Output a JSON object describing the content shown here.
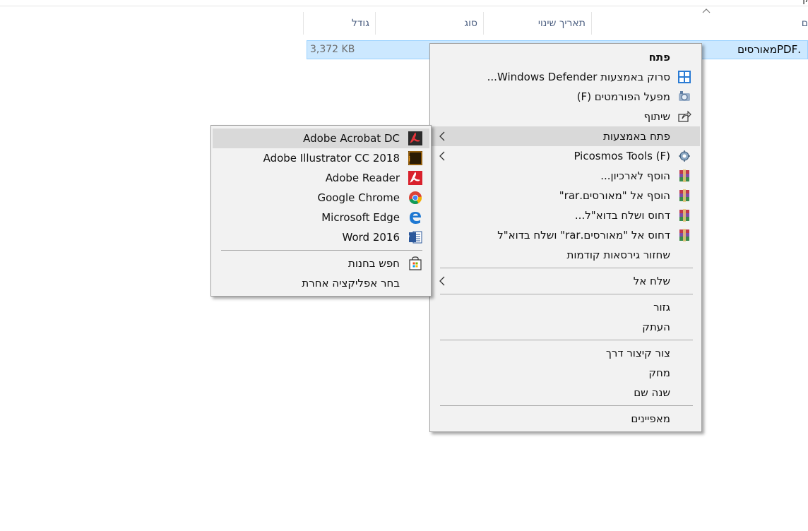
{
  "explorer": {
    "top_char": "ק",
    "columns": {
      "name_char": "ם",
      "modified": "תאריך שינוי",
      "type": "סוג",
      "size": "גודל"
    },
    "selected_file": {
      "name": ".PDFמאורסים",
      "size": "3,372 KB"
    }
  },
  "context_menu": {
    "items": [
      {
        "label": "פתח",
        "icon": "none"
      },
      {
        "label": "סרוק באמצעות Windows Defender...",
        "icon": "defender-icon"
      },
      {
        "label": "מפעל הפורמטים (F)",
        "icon": "format-factory-icon"
      },
      {
        "label": "שיתוף",
        "icon": "share-icon"
      },
      {
        "label": "פתח באמצעות",
        "icon": "none",
        "submenu": true
      },
      {
        "label": "Picosmos Tools (F)",
        "icon": "picosmos-icon",
        "submenu": true
      },
      {
        "label": "הוסף לארכיון...",
        "icon": "winrar-icon"
      },
      {
        "label": "הוסף אל \"מאורסים.rar\"",
        "icon": "winrar-icon"
      },
      {
        "label": "דחוס ושלח בדוא\"ל...",
        "icon": "winrar-icon"
      },
      {
        "label": "דחוס אל \"מאורסים.rar\" ושלח בדוא\"ל",
        "icon": "winrar-icon"
      },
      {
        "label": "שחזור גירסאות קודמות",
        "icon": "none"
      },
      {
        "label": "שלח אל",
        "icon": "none",
        "submenu": true
      },
      {
        "label": "גזור",
        "icon": "none"
      },
      {
        "label": "העתק",
        "icon": "none"
      },
      {
        "label": "צור קיצור דרך",
        "icon": "none"
      },
      {
        "label": "מחק",
        "icon": "none"
      },
      {
        "label": "שנה שם",
        "icon": "none"
      },
      {
        "label": "מאפיינים",
        "icon": "none"
      }
    ]
  },
  "open_with_menu": {
    "items": [
      {
        "label": "Adobe Acrobat DC",
        "icon": "acrobat-icon"
      },
      {
        "label": "Adobe Illustrator CC 2018",
        "icon": "illustrator-icon"
      },
      {
        "label": "Adobe Reader",
        "icon": "adobe-reader-icon"
      },
      {
        "label": "Google Chrome",
        "icon": "chrome-icon"
      },
      {
        "label": "Microsoft Edge",
        "icon": "edge-icon"
      },
      {
        "label": "Word 2016",
        "icon": "word-icon"
      },
      {
        "label": "חפש בחנות",
        "icon": "store-icon"
      },
      {
        "label": "בחר אפליקציה אחרת",
        "icon": "none"
      }
    ]
  }
}
